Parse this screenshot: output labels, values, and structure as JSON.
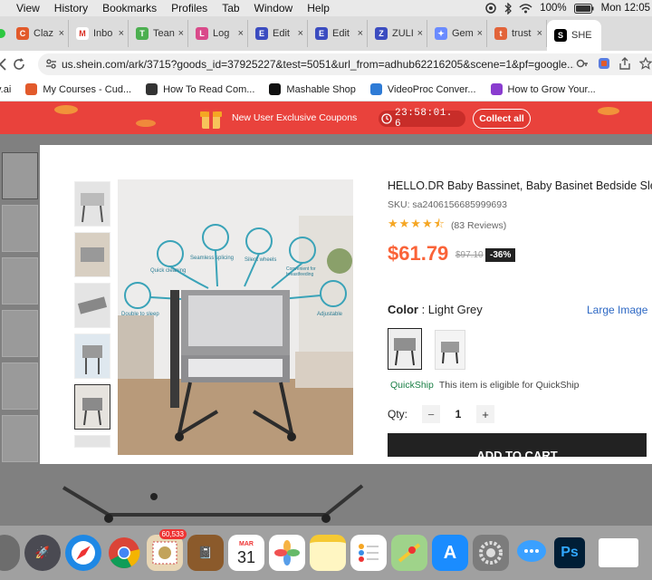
{
  "menubar": {
    "items": [
      "View",
      "History",
      "Bookmarks",
      "Profiles",
      "Tab",
      "Window",
      "Help"
    ],
    "battery": "100%",
    "clock": "Mon 12:05"
  },
  "tabs": [
    {
      "label": "Claz",
      "icon": "claz-icon",
      "color": "#e25a2b",
      "letter": "C"
    },
    {
      "label": "Inbo",
      "icon": "gmail-icon",
      "color": "#ffffff",
      "letter": "M"
    },
    {
      "label": "Tean",
      "icon": "teams-icon",
      "color": "#4caf50",
      "letter": "T"
    },
    {
      "label": "Log",
      "icon": "log-icon",
      "color": "#d94a8a",
      "letter": "L"
    },
    {
      "label": "Edit",
      "icon": "edit-icon",
      "color": "#3b4cc0",
      "letter": "E"
    },
    {
      "label": "Edit",
      "icon": "edit-icon",
      "color": "#3b4cc0",
      "letter": "E"
    },
    {
      "label": "ZULI",
      "icon": "zuli-icon",
      "color": "#3b4cc0",
      "letter": "Z"
    },
    {
      "label": "Gem",
      "icon": "gemini-icon",
      "color": "#6a8bff",
      "letter": "✦"
    },
    {
      "label": "trust",
      "icon": "trust-icon",
      "color": "#e2643a",
      "letter": "t"
    },
    {
      "label": "SHE",
      "icon": "shein-icon",
      "color": "#000000",
      "letter": "S",
      "active": true
    }
  ],
  "url": "us.shein.com/ark/3715?goods_id=37925227&test=5051&url_from=adhub62216205&scene=1&pf=google...",
  "bookmarks": [
    {
      "label": "y.ai",
      "color": "#ffffff"
    },
    {
      "label": "My Courses - Cud...",
      "color": "#e25a2b"
    },
    {
      "label": "How To Read Com...",
      "color": "#333333"
    },
    {
      "label": "Mashable Shop",
      "color": "#111111"
    },
    {
      "label": "VideoProc Conver...",
      "color": "#2e7bd6"
    },
    {
      "label": "How to Grow Your...",
      "color": "#8a3ccf"
    }
  ],
  "promo": {
    "text": "New User Exclusive Coupons",
    "countdown": "23:58:01. 6",
    "collect": "Collect all"
  },
  "product": {
    "title": "HELLO.DR Baby Bassinet, Baby Basinet Bedside Sle...",
    "sku": "SKU: sa2406156685999693",
    "rating": 4.5,
    "reviews": "(83 Reviews)",
    "price": "$61.79",
    "old_price": "$97.10",
    "discount": "-36%",
    "color_label": "Color",
    "color_value": ": Light Grey",
    "large_image": "Large Image",
    "quickship": "QuickShip",
    "quickship_note": "This item is eligible for QuickShip",
    "qty_label": "Qty:",
    "qty_minus": "−",
    "qty_value": "1",
    "qty_plus": "+",
    "add_to_cart": "ADD TO CART"
  },
  "image_features": [
    "Quick cleaning",
    "Seamless splicing",
    "Silent wheels",
    "Convenient for breastfeeding",
    "Double to sleep",
    "Adjustable"
  ],
  "dock": {
    "mail_badge": "60,533",
    "calendar_month": "MAR",
    "calendar_day": "31"
  }
}
